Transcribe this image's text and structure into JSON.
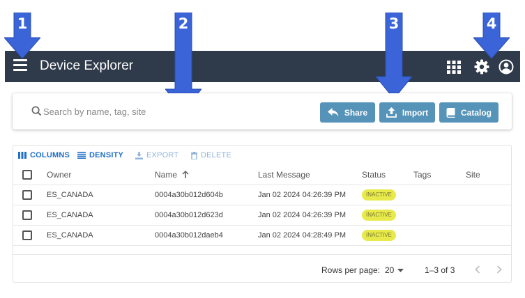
{
  "app": {
    "title": "Device Explorer"
  },
  "callouts": [
    "1",
    "2",
    "3",
    "4"
  ],
  "search": {
    "placeholder": "Search by name, tag, site",
    "value": ""
  },
  "actions": {
    "share": "Share",
    "import": "Import",
    "catalog": "Catalog"
  },
  "toolbar": {
    "columns": "COLUMNS",
    "density": "DENSITY",
    "export": "EXPORT",
    "delete": "DELETE"
  },
  "table": {
    "headers": {
      "owner": "Owner",
      "name": "Name",
      "last_message": "Last Message",
      "status": "Status",
      "tags": "Tags",
      "site": "Site"
    },
    "sort": {
      "column": "Name",
      "direction": "ascending"
    },
    "rows": [
      {
        "owner": "ES_CANADA",
        "name": "0004a30b012d604b",
        "last_message": "Jan 02 2024 04:26:39 PM",
        "status": "INACTIVE",
        "tags": "",
        "site": ""
      },
      {
        "owner": "ES_CANADA",
        "name": "0004a30b012d623d",
        "last_message": "Jan 02 2024 04:26:39 PM",
        "status": "INACTIVE",
        "tags": "",
        "site": ""
      },
      {
        "owner": "ES_CANADA",
        "name": "0004a30b012daeb4",
        "last_message": "Jan 02 2024 04:28:49 PM",
        "status": "INACTIVE",
        "tags": "",
        "site": ""
      }
    ]
  },
  "pagination": {
    "rows_per_page_label": "Rows per page:",
    "rows_per_page": "20",
    "range": "1–3 of 3"
  },
  "colors": {
    "appbar": "#2f3a4a",
    "button": "#5693b9",
    "link": "#1f6fc8",
    "badge": "#e7ea4a",
    "callout": "#3a64d8"
  },
  "icons": [
    "menu-icon",
    "apps-grid-icon",
    "settings-gear-icon",
    "account-circle-icon",
    "search-icon",
    "share-icon",
    "upload-icon",
    "book-icon",
    "columns-icon",
    "density-icon",
    "export-icon",
    "delete-icon",
    "sort-arrow-up-icon",
    "dropdown-arrow-icon",
    "chevron-left-icon",
    "chevron-right-icon"
  ]
}
